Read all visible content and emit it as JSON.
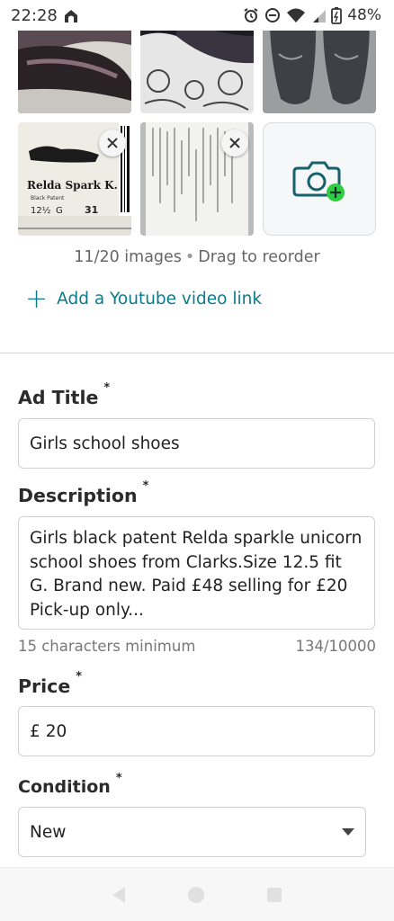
{
  "status_bar": {
    "time": "22:28",
    "battery": "48%"
  },
  "photos": {
    "labels_in_photo": {
      "product_name": "Relda Spark K.",
      "colour": "Black Patent",
      "size": "12½",
      "fit": "G",
      "code": "31"
    },
    "count_text": "11/20 images",
    "reorder_text": "Drag to reorder"
  },
  "youtube": {
    "label": "Add a Youtube video link"
  },
  "ad_title": {
    "label": "Ad Title",
    "required_mark": "*",
    "value": "Girls school shoes"
  },
  "description": {
    "label": "Description",
    "required_mark": "*",
    "value": "Girls black patent Relda sparkle unicorn school shoes from Clarks.Size 12.5 fit G. Brand new. Paid £48 selling for £20 Pick-up only...",
    "hint": "15 characters minimum",
    "counter": "134/10000"
  },
  "price": {
    "label": "Price",
    "required_mark": "*",
    "currency": "£",
    "value": "20"
  },
  "condition": {
    "label": "Condition",
    "required_mark": "*",
    "value": "New"
  },
  "colors": {
    "accent": "#0a7b8c",
    "add_badge": "#2ecc40",
    "border": "#cfd2d5"
  }
}
